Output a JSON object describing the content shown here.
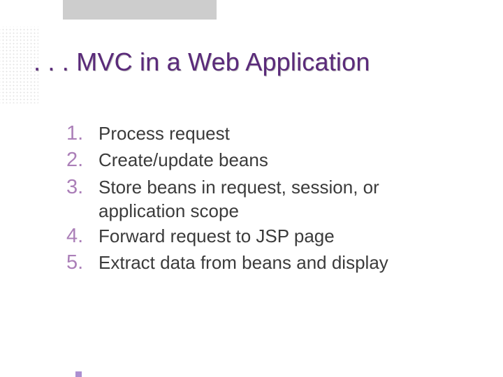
{
  "title": ". . . MVC in a Web Application",
  "items": [
    {
      "n": "1.",
      "t": "Process request"
    },
    {
      "n": "2.",
      "t": "Create/update beans"
    },
    {
      "n": "3.",
      "t": "Store beans in request, session, or application scope"
    },
    {
      "n": "4.",
      "t": "Forward request to JSP page"
    },
    {
      "n": "5.",
      "t": "Extract data from beans and display"
    }
  ]
}
